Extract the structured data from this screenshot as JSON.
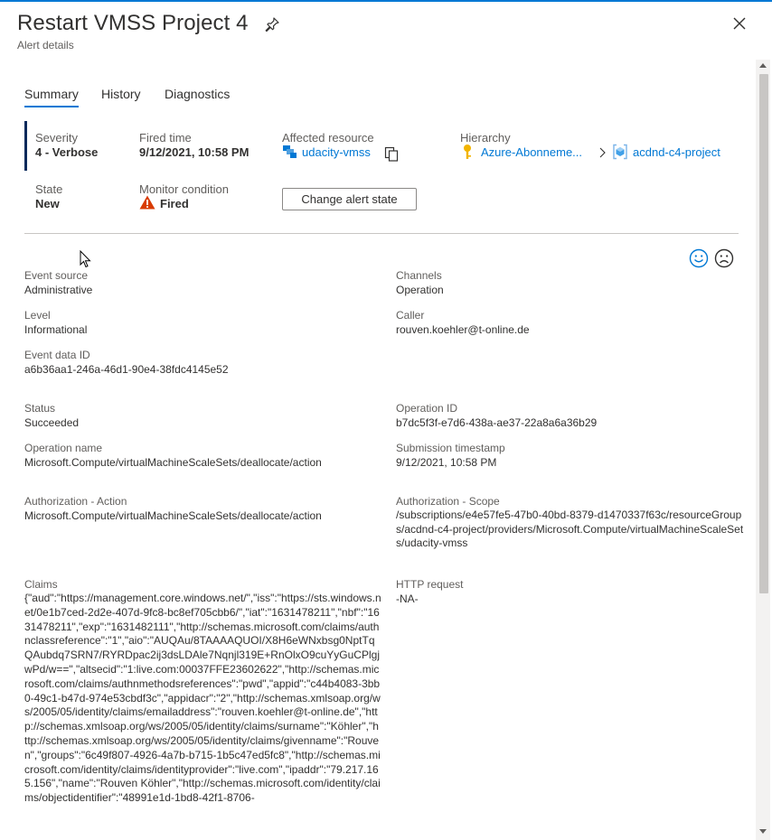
{
  "header": {
    "title": "Restart VMSS Project 4",
    "subtitle": "Alert details"
  },
  "tabs": [
    {
      "label": "Summary",
      "active": true
    },
    {
      "label": "History",
      "active": false
    },
    {
      "label": "Diagnostics",
      "active": false
    }
  ],
  "summary": {
    "severity_label": "Severity",
    "severity_value": "4 - Verbose",
    "fired_time_label": "Fired time",
    "fired_time_value": "9/12/2021, 10:58 PM",
    "affected_resource_label": "Affected resource",
    "affected_resource_value": "udacity-vmss",
    "hierarchy_label": "Hierarchy",
    "hierarchy_subscription": "Azure-Abonneme...",
    "hierarchy_resource_group": "acdnd-c4-project",
    "state_label": "State",
    "state_value": "New",
    "monitor_condition_label": "Monitor condition",
    "monitor_condition_value": "Fired",
    "change_state_button": "Change alert state"
  },
  "details": {
    "event_source_label": "Event source",
    "event_source_value": "Administrative",
    "channels_label": "Channels",
    "channels_value": "Operation",
    "level_label": "Level",
    "level_value": "Informational",
    "caller_label": "Caller",
    "caller_value": "rouven.koehler@t-online.de",
    "event_data_id_label": "Event data ID",
    "event_data_id_value": "a6b36aa1-246a-46d1-90e4-38fdc4145e52",
    "status_label": "Status",
    "status_value": "Succeeded",
    "operation_id_label": "Operation ID",
    "operation_id_value": "b7dc5f3f-e7d6-438a-ae37-22a8a6a36b29",
    "operation_name_label": "Operation name",
    "operation_name_value": "Microsoft.Compute/virtualMachineScaleSets/deallocate/action",
    "submission_timestamp_label": "Submission timestamp",
    "submission_timestamp_value": "9/12/2021, 10:58 PM",
    "authorization_action_label": "Authorization - Action",
    "authorization_action_value": "Microsoft.Compute/virtualMachineScaleSets/deallocate/action",
    "authorization_scope_label": "Authorization - Scope",
    "authorization_scope_value": "/subscriptions/e4e57fe5-47b0-40bd-8379-d1470337f63c/resourceGroups/acdnd-c4-project/providers/Microsoft.Compute/virtualMachineScaleSets/udacity-vmss",
    "claims_label": "Claims",
    "claims_value": "{\"aud\":\"https://management.core.windows.net/\",\"iss\":\"https://sts.windows.net/0e1b7ced-2d2e-407d-9fc8-bc8ef705cbb6/\",\"iat\":\"1631478211\",\"nbf\":\"1631478211\",\"exp\":\"1631482111\",\"http://schemas.microsoft.com/claims/authnclassreference\":\"1\",\"aio\":\"AUQAu/8TAAAAQUOI/X8H6eWNxbsg0NptTqQAubdq7SRN7/RYRDpac2ij3dsLDAle7Nqnjl319E+RnOlxO9cuYyGuCPlgjwPd/w==\",\"altsecid\":\"1:live.com:00037FFE23602622\",\"http://schemas.microsoft.com/claims/authnmethodsreferences\":\"pwd\",\"appid\":\"c44b4083-3bb0-49c1-b47d-974e53cbdf3c\",\"appidacr\":\"2\",\"http://schemas.xmlsoap.org/ws/2005/05/identity/claims/emailaddress\":\"rouven.koehler@t-online.de\",\"http://schemas.xmlsoap.org/ws/2005/05/identity/claims/surname\":\"Köhler\",\"http://schemas.xmlsoap.org/ws/2005/05/identity/claims/givenname\":\"Rouven\",\"groups\":\"6c49f807-4926-4a7b-b715-1b5c47ed5fc8\",\"http://schemas.microsoft.com/identity/claims/identityprovider\":\"live.com\",\"ipaddr\":\"79.217.165.156\",\"name\":\"Rouven Köhler\",\"http://schemas.microsoft.com/identity/claims/objectidentifier\":\"48991e1d-1bd8-42f1-8706-",
    "http_request_label": "HTTP request",
    "http_request_value": "-NA-"
  },
  "colors": {
    "accent": "#0078d4",
    "severity_bar": "#0b2a5b",
    "warning": "#d83b01"
  },
  "icons": {
    "pin": "pin-icon",
    "close": "close-icon",
    "vmss": "vmss-icon",
    "copy": "copy-icon",
    "key": "key-icon",
    "resource_group": "resource-group-icon",
    "warning": "warning-icon",
    "smile": "smile-icon",
    "frown": "frown-icon"
  }
}
